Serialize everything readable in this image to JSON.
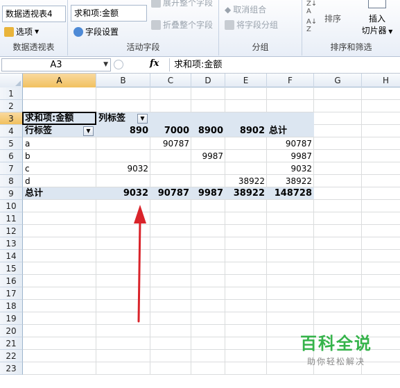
{
  "ribbon": {
    "pivot_group": {
      "name_value": "数据透视表4",
      "options_label": "选项",
      "group_label": "数据透视表"
    },
    "active_field_group": {
      "field_value": "求和项:金额",
      "field_settings_label": "字段设置",
      "expand_label": "展开整个字段",
      "collapse_label": "折叠整个字段",
      "group_label": "活动字段"
    },
    "grouping_group": {
      "ungroup_label": "取消组合",
      "group_field_label": "将字段分组",
      "group_label": "分组"
    },
    "sort_group": {
      "sort_label": "排序",
      "insert_label": "插入",
      "slicer_label": "切片器",
      "group_label": "排序和筛选"
    }
  },
  "formula_bar": {
    "cell_ref": "A3",
    "fx_symbol": "fx",
    "formula": "求和项:金额"
  },
  "columns": [
    "A",
    "B",
    "C",
    "D",
    "E",
    "F",
    "G",
    "H"
  ],
  "rows": [
    "1",
    "2",
    "3",
    "4",
    "5",
    "6",
    "7",
    "8",
    "9",
    "10",
    "11",
    "12",
    "13",
    "14",
    "15",
    "16",
    "17",
    "18",
    "19",
    "20",
    "21",
    "22",
    "23"
  ],
  "pivot": {
    "value_header": "求和项:金额",
    "col_labels_header": "列标签",
    "row_labels_header": "行标签",
    "col_keys": [
      "890",
      "7000",
      "8900",
      "8902"
    ],
    "grand_total_label": "总计",
    "rows": [
      {
        "label": "a",
        "values": [
          "",
          "90787",
          "",
          ""
        ],
        "total": "90787"
      },
      {
        "label": "b",
        "values": [
          "",
          "",
          "9987",
          ""
        ],
        "total": "9987"
      },
      {
        "label": "c",
        "values": [
          "9032",
          "",
          "",
          ""
        ],
        "total": "9032"
      },
      {
        "label": "d",
        "values": [
          "",
          "",
          "",
          "38922"
        ],
        "total": "38922"
      }
    ],
    "totals": {
      "values": [
        "9032",
        "90787",
        "9987",
        "38922"
      ],
      "grand": "148728"
    }
  },
  "annotation": {
    "arrow_color": "#d9232a"
  },
  "watermark": {
    "title": "百科全说",
    "subtitle": "助你轻松解决",
    "color": "#35b34a"
  }
}
